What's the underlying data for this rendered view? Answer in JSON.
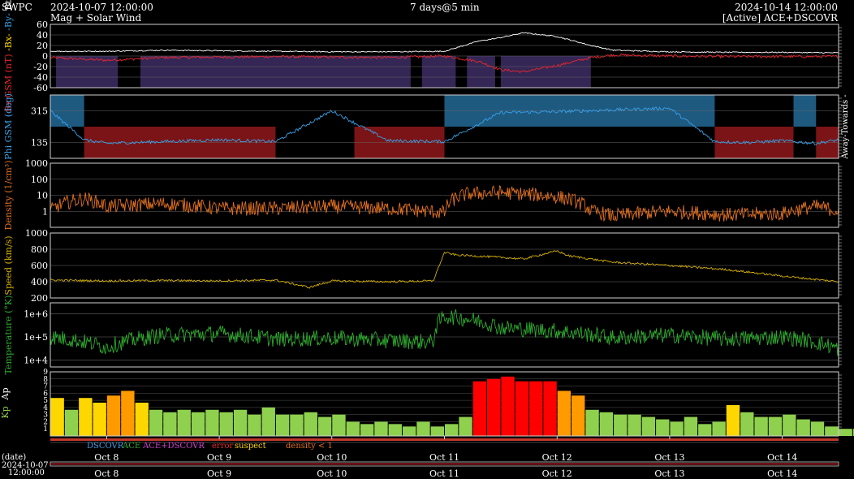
{
  "header": {
    "agency": "SWPC",
    "start_date": "2024-10-07 12:00:00",
    "subtitle": "Mag + Solar Wind",
    "span": "7 days@5 min",
    "end_date": "2024-10-14 12:00:00",
    "source": "[Active] ACE+DSCOVR"
  },
  "colors": {
    "bz": "#e8262e",
    "bt": "#ffffff",
    "bx": "#ffd700",
    "by": "#3aa0e8",
    "phi": "#3aa0e8",
    "density": "#e07020",
    "speed": "#d4b000",
    "temperature": "#2eaa2e",
    "kp_green": "#8fd14f",
    "kp_yellow": "#ffd700",
    "kp_orange": "#ff9a00",
    "kp_red": "#ff0000"
  },
  "legend": {
    "dscovr": "DSCOVR",
    "ace": "ACE",
    "ace_dscovr": "ACE+DSCOVR",
    "error": "error",
    "suspect": "suspect",
    "density_low": "density < 1"
  },
  "footer": {
    "date_label": "(date)",
    "date_value": "2024-10-07",
    "time_value": "12:00:00"
  },
  "side_label": "Away-Towards -",
  "chart_data": [
    {
      "type": "line",
      "name": "mag",
      "ylabel": "Bz GSM (nT) Bt",
      "ylabel_parts": [
        "Bz GSM (nT)",
        "-Bx-",
        "-By-",
        "Bt"
      ],
      "ylim": [
        -60,
        60
      ],
      "yticks": [
        "60",
        "40",
        "20",
        "0",
        "-20",
        "-40",
        "-60"
      ],
      "ytick_values": [
        60,
        40,
        20,
        0,
        -20,
        -40,
        -60
      ],
      "series": [
        {
          "name": "Bt",
          "x": [
            0,
            0.5,
            1,
            1.5,
            2,
            2.5,
            3,
            3.5,
            3.8,
            4,
            4.2,
            4.5,
            4.8,
            5,
            5.5,
            6,
            6.5,
            7
          ],
          "values": [
            9,
            9,
            11,
            10,
            9,
            8,
            8,
            9,
            28,
            35,
            44,
            37,
            20,
            11,
            8,
            7,
            7,
            6
          ]
        },
        {
          "name": "Bz",
          "x": [
            0,
            0.5,
            1,
            1.5,
            2,
            2.5,
            3,
            3.5,
            3.8,
            4,
            4.2,
            4.5,
            4.8,
            5,
            5.5,
            6,
            6.5,
            7
          ],
          "values": [
            -3,
            -8,
            -3,
            -2,
            -1,
            -2,
            -3,
            0,
            -10,
            -26,
            -30,
            -18,
            -3,
            2,
            0,
            -1,
            -1,
            -1
          ]
        }
      ]
    },
    {
      "type": "line",
      "name": "phi",
      "ylabel": "Phi GSM (deg)",
      "yticks": [
        "315",
        "135"
      ],
      "ytick_values": [
        315,
        135
      ],
      "ylim": [
        45,
        405
      ],
      "sectors": [
        {
          "start": 0,
          "end": 0.3,
          "sector": "towards"
        },
        {
          "start": 0.3,
          "end": 2.0,
          "sector": "away"
        },
        {
          "start": 2.0,
          "end": 2.7,
          "sector": "mixed"
        },
        {
          "start": 2.7,
          "end": 3.5,
          "sector": "away"
        },
        {
          "start": 3.5,
          "end": 5.9,
          "sector": "towards"
        },
        {
          "start": 5.9,
          "end": 6.6,
          "sector": "away"
        },
        {
          "start": 6.6,
          "end": 6.8,
          "sector": "towards"
        },
        {
          "start": 6.8,
          "end": 7.0,
          "sector": "away"
        }
      ],
      "x": [
        0,
        0.3,
        0.5,
        1,
        1.5,
        2,
        2.5,
        3,
        3.5,
        4,
        4.5,
        5,
        5.5,
        5.9,
        6.2,
        6.5,
        6.8,
        7
      ],
      "values": [
        315,
        150,
        130,
        140,
        150,
        140,
        315,
        145,
        140,
        305,
        310,
        320,
        330,
        140,
        135,
        145,
        130,
        150
      ]
    },
    {
      "type": "line",
      "name": "density",
      "ylabel": "Density (1/cm³)",
      "yscale": "log",
      "yticks": [
        "1000",
        "100",
        "10",
        "1"
      ],
      "ytick_values": [
        1000,
        100,
        10,
        1
      ],
      "ylim": [
        0.1,
        1000
      ],
      "x": [
        0,
        0.3,
        0.5,
        1,
        1.5,
        2,
        2.5,
        3,
        3.5,
        3.7,
        4,
        4.5,
        4.8,
        5,
        5.5,
        6,
        6.5,
        6.8,
        7
      ],
      "values": [
        1,
        6,
        2,
        3,
        1.5,
        1.5,
        2,
        1.5,
        0.8,
        12,
        15,
        8,
        1,
        0.5,
        1,
        0.6,
        0.7,
        2,
        1
      ]
    },
    {
      "type": "line",
      "name": "speed",
      "ylabel": "Speed (km/s)",
      "yticks": [
        "1000",
        "800",
        "600",
        "400",
        "200"
      ],
      "ytick_values": [
        1000,
        800,
        600,
        400,
        200
      ],
      "ylim": [
        200,
        1000
      ],
      "x": [
        0,
        0.5,
        1,
        1.5,
        2,
        2.3,
        2.5,
        3,
        3.4,
        3.5,
        3.6,
        4,
        4.2,
        4.5,
        4.6,
        5,
        5.5,
        6,
        6.5,
        7
      ],
      "values": [
        420,
        410,
        415,
        410,
        420,
        330,
        410,
        400,
        410,
        760,
        730,
        700,
        680,
        780,
        720,
        640,
        600,
        550,
        470,
        400
      ]
    },
    {
      "type": "line",
      "name": "temperature",
      "ylabel": "Temperature (°K)",
      "yscale": "log",
      "yticks": [
        "1e+6",
        "1e+5",
        "1e+4"
      ],
      "ytick_values": [
        1000000,
        100000,
        10000
      ],
      "ylim": [
        5000,
        3000000
      ],
      "x": [
        0,
        0.5,
        1,
        1.5,
        2,
        2.5,
        3,
        3.4,
        3.5,
        3.8,
        4,
        4.5,
        5,
        5.5,
        6,
        6.5,
        7
      ],
      "values": [
        100000,
        35000,
        120000,
        140000,
        80000,
        90000,
        70000,
        60000,
        800000,
        500000,
        250000,
        180000,
        90000,
        120000,
        80000,
        100000,
        30000
      ]
    },
    {
      "type": "bar",
      "name": "kp",
      "ylabel": "Kp Ap",
      "ylim": [
        0,
        9
      ],
      "yticks": [
        "9",
        "8",
        "7",
        "6",
        "5",
        "4",
        "3",
        "2",
        "1"
      ],
      "ytick_values": [
        9,
        8,
        7,
        6,
        5,
        4,
        3,
        2,
        1
      ],
      "bar_hours": 3,
      "values": [
        5.33,
        3.67,
        5.33,
        4.67,
        5.67,
        6.33,
        4.67,
        3.67,
        3.33,
        3.67,
        3.33,
        3.67,
        3.33,
        3.67,
        3.0,
        4.0,
        3.0,
        3.0,
        3.33,
        2.67,
        3.0,
        2.0,
        1.67,
        2.0,
        1.67,
        1.33,
        2.0,
        1.33,
        1.67,
        2.67,
        7.67,
        8.0,
        8.33,
        7.67,
        7.67,
        7.67,
        6.33,
        5.67,
        3.67,
        3.33,
        3.0,
        3.0,
        2.67,
        2.33,
        2.0,
        2.67,
        1.67,
        2.0,
        4.33,
        3.33,
        2.67,
        2.67,
        3.0,
        2.33,
        2.0,
        1.33,
        1.0,
        1.0,
        1.67,
        1.33,
        1.0,
        1.0,
        0.67,
        0.67,
        0.67,
        0.33
      ]
    }
  ],
  "x_axis": {
    "ticks": [
      "Oct 8",
      "Oct 9",
      "Oct 10",
      "Oct 11",
      "Oct 12",
      "Oct 13",
      "Oct 14"
    ],
    "tick_days": [
      0.5,
      1.5,
      2.5,
      3.5,
      4.5,
      5.5,
      6.5
    ]
  }
}
